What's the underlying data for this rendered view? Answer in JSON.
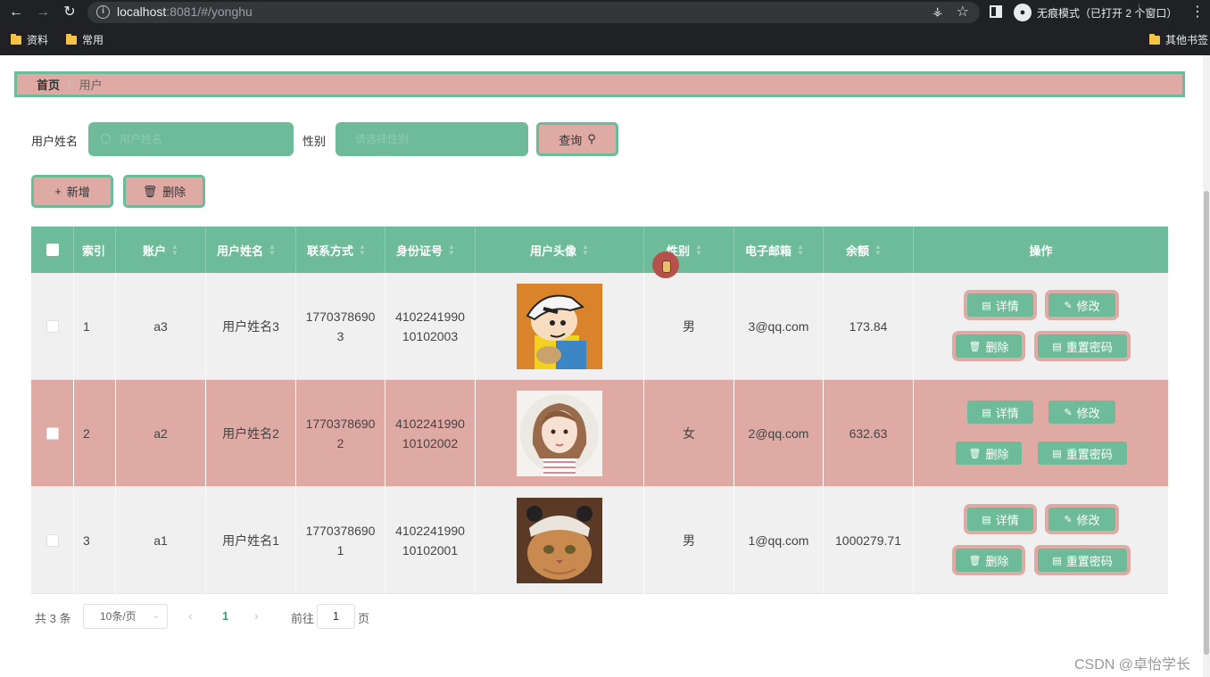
{
  "browser": {
    "url_host": "localhost",
    "url_rest": ":8081/#/yonghu",
    "incognito_label": "无痕模式（已打开 2 个窗口）",
    "bookmarks": [
      "资料",
      "常用"
    ],
    "other_bookmarks": "其他书签"
  },
  "breadcrumb": {
    "home": "首页",
    "separator": "/",
    "current": "用户"
  },
  "search": {
    "name_label": "用户姓名",
    "name_placeholder": "用户姓名",
    "gender_label": "性别",
    "gender_placeholder": "请选择性别",
    "query_button": "查询"
  },
  "actions": {
    "add": "新增",
    "delete": "删除"
  },
  "table": {
    "headers": {
      "index": "索引",
      "account": "账户",
      "name": "用户姓名",
      "phone": "联系方式",
      "id_card": "身份证号",
      "avatar": "用户头像",
      "gender": "性别",
      "email": "电子邮箱",
      "balance": "余额",
      "ops": "操作"
    },
    "rows": [
      {
        "index": "1",
        "account": "a3",
        "name": "用户姓名3",
        "phone_1": "1770378690",
        "phone_2": "3",
        "id_1": "4102241990",
        "id_2": "10102003",
        "gender": "男",
        "email": "3@qq.com",
        "balance": "173.84"
      },
      {
        "index": "2",
        "account": "a2",
        "name": "用户姓名2",
        "phone_1": "1770378690",
        "phone_2": "2",
        "id_1": "4102241990",
        "id_2": "10102002",
        "gender": "女",
        "email": "2@qq.com",
        "balance": "632.63"
      },
      {
        "index": "3",
        "account": "a1",
        "name": "用户姓名1",
        "phone_1": "1770378690",
        "phone_2": "1",
        "id_1": "4102241990",
        "id_2": "10102001",
        "gender": "男",
        "email": "1@qq.com",
        "balance": "1000279.71"
      }
    ],
    "op_labels": {
      "detail": "详情",
      "edit": "修改",
      "delete": "删除",
      "reset": "重置密码"
    }
  },
  "pagination": {
    "total": "共 3 条",
    "page_size": "10条/页",
    "current_page": "1",
    "goto_label": "前往",
    "goto_value": "1",
    "goto_suffix": "页"
  },
  "watermark": "CSDN @卓怡学长",
  "colors": {
    "accent_green": "#6ebb9a",
    "accent_pink": "#dfa9a4"
  }
}
